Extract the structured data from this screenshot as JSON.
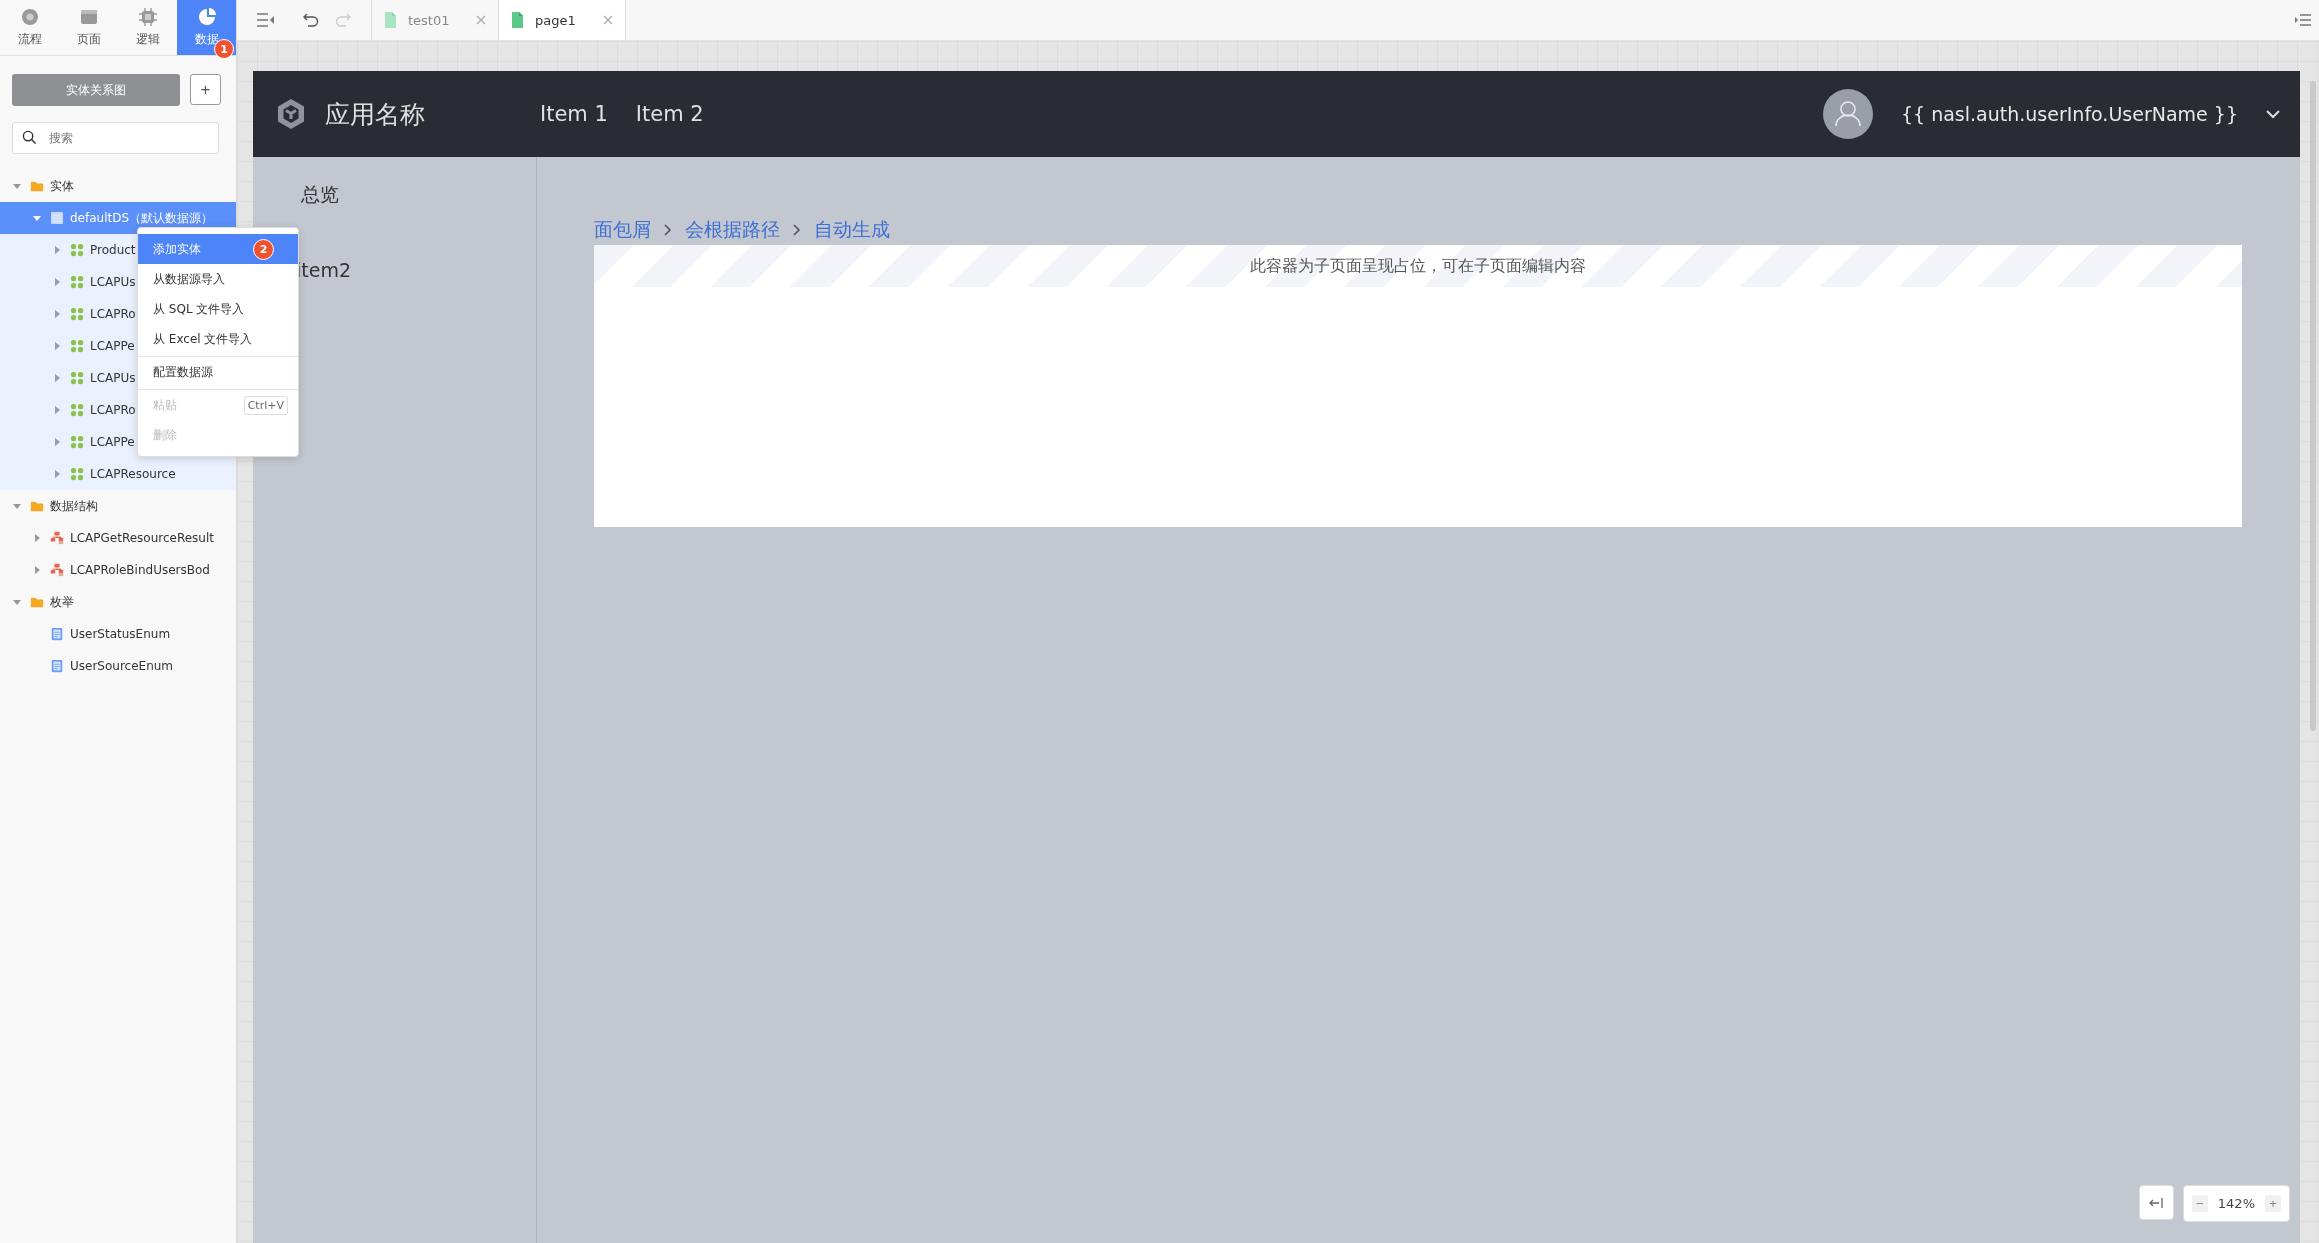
{
  "mode_tabs": [
    {
      "label": "流程",
      "kind": "flow",
      "selected": false
    },
    {
      "label": "页面",
      "kind": "page",
      "selected": false
    },
    {
      "label": "逻辑",
      "kind": "logic",
      "selected": false
    },
    {
      "label": "数据",
      "kind": "data",
      "selected": true,
      "badge": "1"
    }
  ],
  "file_tabs": [
    {
      "label": "test01",
      "selected": false
    },
    {
      "label": "page1",
      "selected": true
    }
  ],
  "sidebar": {
    "diagram_button": "实体关系图",
    "add_button": "+",
    "search": {
      "placeholder": "搜索"
    },
    "tree": [
      {
        "label": "实体",
        "kind": "folder",
        "expanded": true,
        "selected": false,
        "children": [
          {
            "label": "defaultDS（默认数据源）",
            "kind": "datasource",
            "expanded": true,
            "selected": true,
            "children": [
              {
                "label": "Product",
                "kind": "entity",
                "expanded": false,
                "selected": false
              },
              {
                "label": "LCAPUs",
                "kind": "entity",
                "expanded": false,
                "selected": false
              },
              {
                "label": "LCAPRo",
                "kind": "entity",
                "expanded": false,
                "selected": false
              },
              {
                "label": "LCAPPe",
                "kind": "entity",
                "expanded": false,
                "selected": false
              },
              {
                "label": "LCAPUs",
                "kind": "entity",
                "expanded": false,
                "selected": false
              },
              {
                "label": "LCAPRo",
                "kind": "entity",
                "expanded": false,
                "selected": false
              },
              {
                "label": "LCAPPe",
                "kind": "entity",
                "expanded": false,
                "selected": false
              },
              {
                "label": "LCAPResource",
                "kind": "entity",
                "expanded": false,
                "selected": false
              }
            ]
          }
        ]
      },
      {
        "label": "数据结构",
        "kind": "folder",
        "expanded": true,
        "selected": false,
        "children": [
          {
            "label": "LCAPGetResourceResult",
            "kind": "structure",
            "expanded": false,
            "selected": false
          },
          {
            "label": "LCAPRoleBindUsersBod",
            "kind": "structure",
            "expanded": false,
            "selected": false
          }
        ]
      },
      {
        "label": "枚举",
        "kind": "folder",
        "expanded": true,
        "selected": false,
        "children": [
          {
            "label": "UserStatusEnum",
            "kind": "enum",
            "selected": false
          },
          {
            "label": "UserSourceEnum",
            "kind": "enum",
            "selected": false
          }
        ]
      }
    ]
  },
  "context_menu": {
    "items": [
      {
        "label": "添加实体",
        "selected": true,
        "disabled": false,
        "divider_before": false,
        "badge": "2"
      },
      {
        "label": "从数据源导入",
        "selected": false,
        "disabled": false,
        "divider_before": false
      },
      {
        "label": "从 SQL 文件导入",
        "selected": false,
        "disabled": false,
        "divider_before": false
      },
      {
        "label": "从 Excel 文件导入",
        "selected": false,
        "disabled": false,
        "divider_before": false
      },
      {
        "label": "配置数据源",
        "selected": false,
        "disabled": false,
        "divider_before": true
      },
      {
        "label": "粘贴",
        "selected": false,
        "disabled": true,
        "divider_before": true,
        "shortcut": "Ctrl+V"
      },
      {
        "label": "删除",
        "selected": false,
        "disabled": true,
        "divider_before": false
      }
    ]
  },
  "preview": {
    "app_title": "应用名称",
    "nav": [
      "Item 1",
      "Item 2"
    ],
    "user": "{{ nasl.auth.userInfo.UserName }}",
    "side_nav": [
      "总览",
      "item2"
    ],
    "breadcrumb": [
      "面包屑",
      "会根据路径",
      "自动生成"
    ],
    "placeholder_text": "此容器为子页面呈现占位，可在子页面编辑内容"
  },
  "zoom": {
    "minus": "−",
    "reading": "142%",
    "plus": "+"
  }
}
